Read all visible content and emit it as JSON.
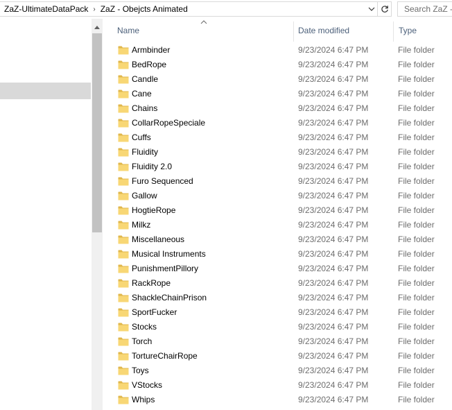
{
  "address_bar": {
    "breadcrumbs": [
      "ZaZ-UltimateDataPack",
      "ZaZ - Obejcts Animated"
    ],
    "search_placeholder": "Search ZaZ -"
  },
  "columns": {
    "name": "Name",
    "date_modified": "Date modified",
    "type": "Type"
  },
  "files": [
    {
      "name": "Armbinder",
      "date": "9/23/2024 6:47 PM",
      "type": "File folder"
    },
    {
      "name": "BedRope",
      "date": "9/23/2024 6:47 PM",
      "type": "File folder"
    },
    {
      "name": "Candle",
      "date": "9/23/2024 6:47 PM",
      "type": "File folder"
    },
    {
      "name": "Cane",
      "date": "9/23/2024 6:47 PM",
      "type": "File folder"
    },
    {
      "name": "Chains",
      "date": "9/23/2024 6:47 PM",
      "type": "File folder"
    },
    {
      "name": "CollarRopeSpeciale",
      "date": "9/23/2024 6:47 PM",
      "type": "File folder"
    },
    {
      "name": "Cuffs",
      "date": "9/23/2024 6:47 PM",
      "type": "File folder"
    },
    {
      "name": "Fluidity",
      "date": "9/23/2024 6:47 PM",
      "type": "File folder"
    },
    {
      "name": "Fluidity 2.0",
      "date": "9/23/2024 6:47 PM",
      "type": "File folder"
    },
    {
      "name": "Furo Sequenced",
      "date": "9/23/2024 6:47 PM",
      "type": "File folder"
    },
    {
      "name": "Gallow",
      "date": "9/23/2024 6:47 PM",
      "type": "File folder"
    },
    {
      "name": "HogtieRope",
      "date": "9/23/2024 6:47 PM",
      "type": "File folder"
    },
    {
      "name": "Milkz",
      "date": "9/23/2024 6:47 PM",
      "type": "File folder"
    },
    {
      "name": "Miscellaneous",
      "date": "9/23/2024 6:47 PM",
      "type": "File folder"
    },
    {
      "name": "Musical Instruments",
      "date": "9/23/2024 6:47 PM",
      "type": "File folder"
    },
    {
      "name": "PunishmentPillory",
      "date": "9/23/2024 6:47 PM",
      "type": "File folder"
    },
    {
      "name": "RackRope",
      "date": "9/23/2024 6:47 PM",
      "type": "File folder"
    },
    {
      "name": "ShackleChainPrison",
      "date": "9/23/2024 6:47 PM",
      "type": "File folder"
    },
    {
      "name": "SportFucker",
      "date": "9/23/2024 6:47 PM",
      "type": "File folder"
    },
    {
      "name": "Stocks",
      "date": "9/23/2024 6:47 PM",
      "type": "File folder"
    },
    {
      "name": "Torch",
      "date": "9/23/2024 6:47 PM",
      "type": "File folder"
    },
    {
      "name": "TortureChairRope",
      "date": "9/23/2024 6:47 PM",
      "type": "File folder"
    },
    {
      "name": "Toys",
      "date": "9/23/2024 6:47 PM",
      "type": "File folder"
    },
    {
      "name": "VStocks",
      "date": "9/23/2024 6:47 PM",
      "type": "File folder"
    },
    {
      "name": "Whips",
      "date": "9/23/2024 6:47 PM",
      "type": "File folder"
    }
  ],
  "colors": {
    "folder_yellow": "#f8d775",
    "folder_dark": "#e0b74c",
    "header_text": "#4c607a",
    "meta_text": "#6d6d6d",
    "nav_selection": "#d9d9d9"
  }
}
